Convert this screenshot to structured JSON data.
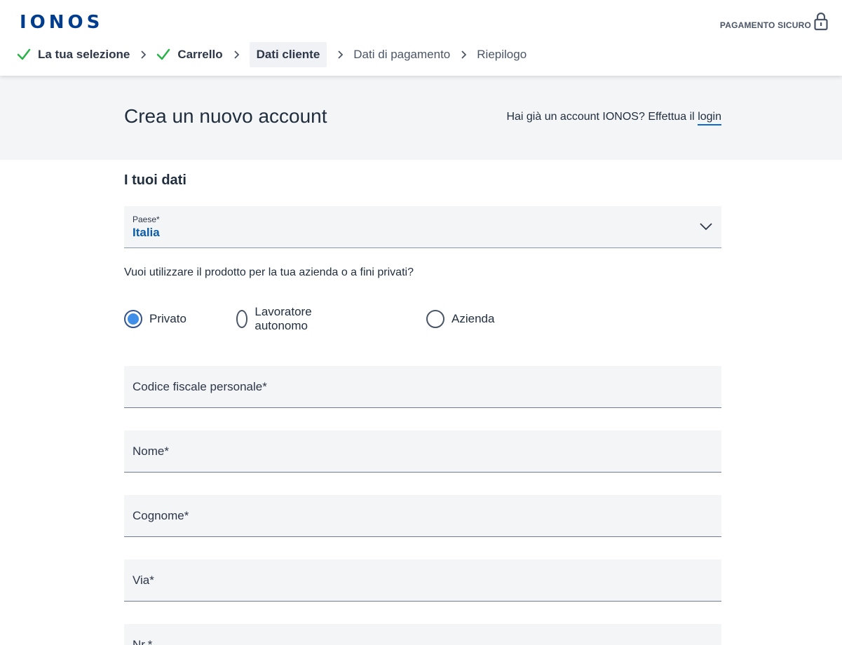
{
  "brand": {
    "logo": "IONOS",
    "secure_label": "PAGAMENTO SICURO"
  },
  "steps": [
    {
      "label": "La tua selezione",
      "state": "done"
    },
    {
      "label": "Carrello",
      "state": "done"
    },
    {
      "label": "Dati cliente",
      "state": "active"
    },
    {
      "label": "Dati di pagamento",
      "state": "todo"
    },
    {
      "label": "Riepilogo",
      "state": "todo"
    }
  ],
  "band": {
    "title": "Crea un nuovo account",
    "login_prompt": "Hai già un account IONOS? Effettua il",
    "login_link": "login"
  },
  "form": {
    "section_title": "I tuoi dati",
    "country": {
      "label": "Paese*",
      "value": "Italia"
    },
    "question": "Vuoi utilizzare il prodotto per la tua azienda o a fini privati?",
    "radios": [
      {
        "label": "Privato",
        "selected": true
      },
      {
        "label": "Lavoratore autonomo",
        "selected": false
      },
      {
        "label": "Azienda",
        "selected": false
      }
    ],
    "fields": [
      {
        "placeholder": "Codice fiscale personale*",
        "value": ""
      },
      {
        "placeholder": "Nome*",
        "value": ""
      },
      {
        "placeholder": "Cognome*",
        "value": ""
      },
      {
        "placeholder": "Via*",
        "value": ""
      },
      {
        "placeholder": "Nr.*",
        "value": ""
      }
    ]
  },
  "colors": {
    "brand": "#003d8f",
    "check": "#2bb34a",
    "accent": "#3f8ee8",
    "link": "#0b5cab"
  },
  "icons": {
    "check": "check-icon",
    "chevron": "chevron-right-icon",
    "lock": "lock-icon",
    "dropdown": "chevron-down-icon"
  }
}
